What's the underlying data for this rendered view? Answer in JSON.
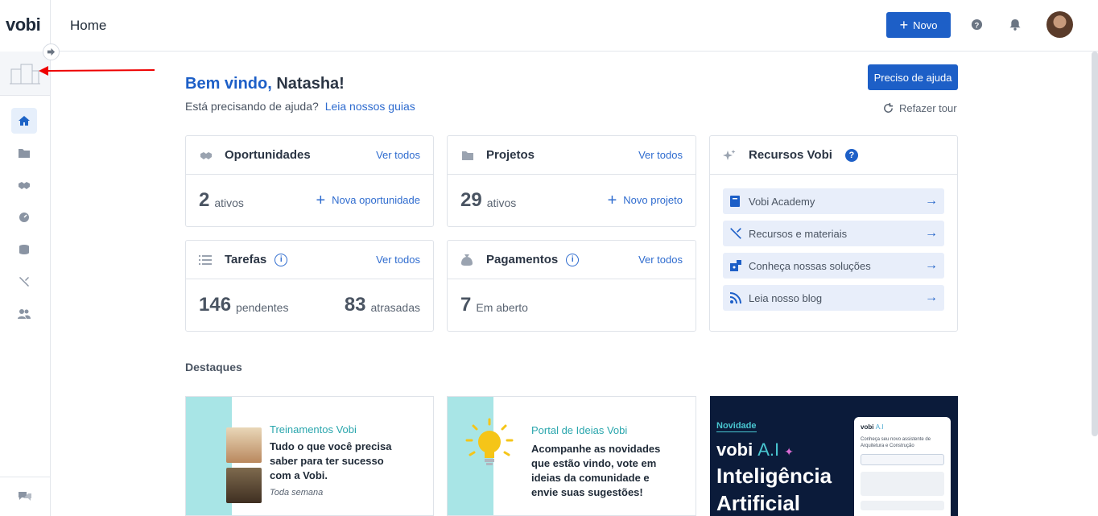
{
  "app": {
    "logo": "vobi",
    "page_title": "Home"
  },
  "topbar": {
    "new_label": "Novo"
  },
  "welcome": {
    "greeting": "Bem vindo,",
    "name": "Natasha!",
    "help_prompt": "Está precisando de ajuda?",
    "help_link": "Leia nossos guias",
    "help_button": "Preciso de ajuda",
    "redo_tour": "Refazer tour"
  },
  "cards": {
    "oportunidades": {
      "title": "Oportunidades",
      "see_all": "Ver todos",
      "count": "2",
      "count_label": "ativos",
      "action": "Nova oportunidade"
    },
    "projetos": {
      "title": "Projetos",
      "see_all": "Ver todos",
      "count": "29",
      "count_label": "ativos",
      "action": "Novo projeto"
    },
    "tarefas": {
      "title": "Tarefas",
      "see_all": "Ver todos",
      "pending": "146",
      "pending_label": "pendentes",
      "late": "83",
      "late_label": "atrasadas"
    },
    "pagamentos": {
      "title": "Pagamentos",
      "see_all": "Ver todos",
      "count": "7",
      "count_label": "Em aberto"
    },
    "recursos": {
      "title": "Recursos Vobi",
      "items": [
        {
          "label": "Vobi Academy"
        },
        {
          "label": "Recursos e materiais"
        },
        {
          "label": "Conheça nossas soluções"
        },
        {
          "label": "Leia nosso blog"
        }
      ]
    }
  },
  "highlights": {
    "title": "Destaques",
    "training": {
      "tag": "Treinamentos Vobi",
      "text": "Tudo o que você precisa saber para ter sucesso com a Vobi.",
      "note": "Toda semana"
    },
    "ideas": {
      "tag": "Portal de Ideias Vobi",
      "text": "Acompanhe as novidades que estão vindo, vote em ideias da comunidade e envie suas sugestões!"
    },
    "ai": {
      "badge": "Novidade",
      "brand": "vobi",
      "brand_ai": "A.I",
      "headline_1": "Inteligência",
      "headline_2": "Artificial",
      "panel_title": "vobi",
      "panel_title_ai": "A.I",
      "panel_desc": "Conheça seu novo assistente de Arquitetura e Construção"
    }
  }
}
